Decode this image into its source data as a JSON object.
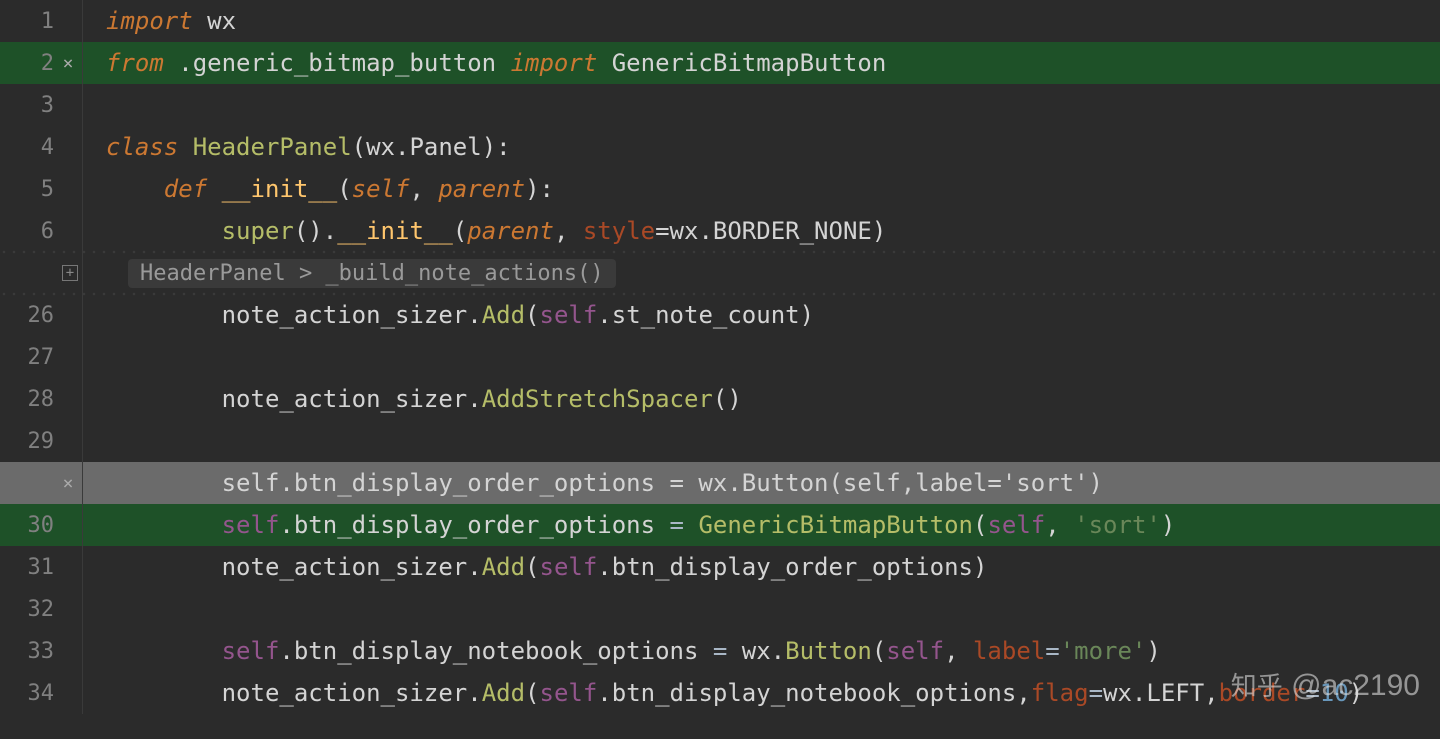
{
  "lines": {
    "l1": {
      "num": "1",
      "tokens": [
        [
          "kw",
          "import"
        ],
        [
          "plain",
          " wx"
        ]
      ]
    },
    "l2": {
      "num": "2",
      "added": true,
      "marker": "×",
      "tokens": [
        [
          "kw",
          "from"
        ],
        [
          "plain",
          " .generic_bitmap_button "
        ],
        [
          "kw",
          "import"
        ],
        [
          "plain",
          " GenericBitmapButton"
        ]
      ]
    },
    "l3": {
      "num": "3",
      "tokens": []
    },
    "l4": {
      "num": "4",
      "tokens": [
        [
          "kw",
          "class"
        ],
        [
          "plain",
          " "
        ],
        [
          "clsname",
          "HeaderPanel"
        ],
        [
          "plain",
          "(wx.Panel):"
        ]
      ]
    },
    "l5": {
      "num": "5",
      "tokens": [
        [
          "plain",
          "    "
        ],
        [
          "kw",
          "def"
        ],
        [
          "plain",
          " "
        ],
        [
          "fnname",
          "__init__"
        ],
        [
          "plain",
          "("
        ],
        [
          "param",
          "self"
        ],
        [
          "plain",
          ", "
        ],
        [
          "param",
          "parent"
        ],
        [
          "plain",
          "):"
        ]
      ]
    },
    "l6": {
      "num": "6",
      "tokens": [
        [
          "plain",
          "        "
        ],
        [
          "call",
          "super"
        ],
        [
          "plain",
          "()."
        ],
        [
          "fnname",
          "__init__"
        ],
        [
          "plain",
          "("
        ],
        [
          "param",
          "parent"
        ],
        [
          "plain",
          ", "
        ],
        [
          "kwarg",
          "style"
        ],
        [
          "plain",
          "=wx.BORDER_NONE)"
        ]
      ]
    },
    "fold": {
      "label": "HeaderPanel > _build_note_actions()"
    },
    "l26": {
      "num": "26",
      "tokens": [
        [
          "plain",
          "        note_action_sizer."
        ],
        [
          "call",
          "Add"
        ],
        [
          "plain",
          "("
        ],
        [
          "self",
          "self"
        ],
        [
          "plain",
          ".st_note_count)"
        ]
      ]
    },
    "l27": {
      "num": "27",
      "tokens": []
    },
    "l28": {
      "num": "28",
      "tokens": [
        [
          "plain",
          "        note_action_sizer."
        ],
        [
          "call",
          "AddStretchSpacer"
        ],
        [
          "plain",
          "()"
        ]
      ]
    },
    "l29": {
      "num": "29",
      "tokens": []
    },
    "lrm": {
      "num": "",
      "removed": true,
      "marker": "×",
      "tokens": [
        [
          "plain",
          "        self.btn_display_order_options = wx.Button(self,label='sort')"
        ]
      ]
    },
    "l30": {
      "num": "30",
      "added": true,
      "tokens": [
        [
          "plain",
          "        "
        ],
        [
          "self",
          "self"
        ],
        [
          "plain",
          ".btn_display_order_options "
        ],
        [
          "op",
          "="
        ],
        [
          "plain",
          " "
        ],
        [
          "call",
          "GenericBitmapButton"
        ],
        [
          "plain",
          "("
        ],
        [
          "self",
          "self"
        ],
        [
          "plain",
          ", "
        ],
        [
          "str",
          "'sort'"
        ],
        [
          "plain",
          ")"
        ]
      ]
    },
    "l31": {
      "num": "31",
      "tokens": [
        [
          "plain",
          "        note_action_sizer."
        ],
        [
          "call",
          "Add"
        ],
        [
          "plain",
          "("
        ],
        [
          "self",
          "self"
        ],
        [
          "plain",
          ".btn_display_order_options)"
        ]
      ]
    },
    "l32": {
      "num": "32",
      "tokens": []
    },
    "l33": {
      "num": "33",
      "tokens": [
        [
          "plain",
          "        "
        ],
        [
          "self",
          "self"
        ],
        [
          "plain",
          ".btn_display_notebook_options "
        ],
        [
          "op",
          "="
        ],
        [
          "plain",
          " wx."
        ],
        [
          "call",
          "Button"
        ],
        [
          "plain",
          "("
        ],
        [
          "self",
          "self"
        ],
        [
          "plain",
          ", "
        ],
        [
          "kwarg",
          "label"
        ],
        [
          "op",
          "="
        ],
        [
          "str",
          "'more'"
        ],
        [
          "plain",
          ")"
        ]
      ]
    },
    "l34": {
      "num": "34",
      "tokens": [
        [
          "plain",
          "        note_action_sizer."
        ],
        [
          "call",
          "Add"
        ],
        [
          "plain",
          "("
        ],
        [
          "self",
          "self"
        ],
        [
          "plain",
          ".btn_display_notebook_options,"
        ],
        [
          "kwarg",
          "flag"
        ],
        [
          "op",
          "="
        ],
        [
          "plain",
          "wx.LEFT,"
        ],
        [
          "kwarg",
          "border"
        ],
        [
          "op",
          "="
        ],
        [
          "num",
          "10"
        ],
        [
          "plain",
          ")"
        ]
      ]
    }
  },
  "order": [
    "l1",
    "l2",
    "l3",
    "l4",
    "l5",
    "l6",
    "fold",
    "l26",
    "l27",
    "l28",
    "l29",
    "lrm",
    "l30",
    "l31",
    "l32",
    "l33",
    "l34"
  ],
  "watermark": {
    "prefix": "知乎",
    "handle": "@ac2190"
  }
}
